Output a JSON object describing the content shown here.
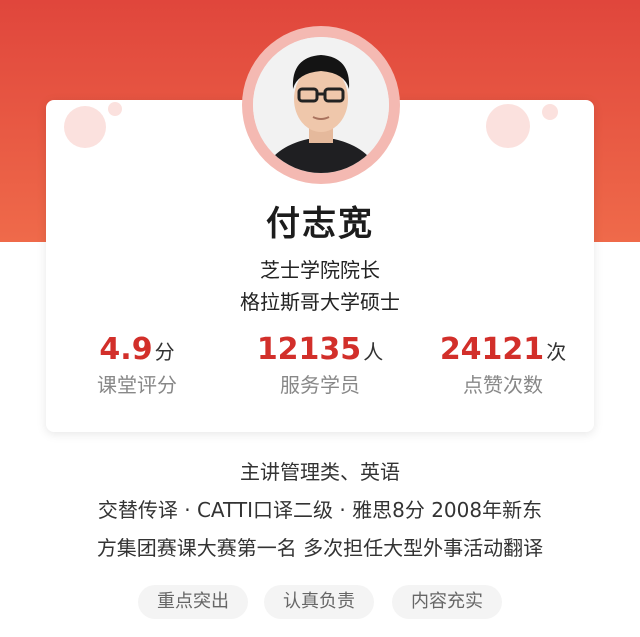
{
  "profile": {
    "name": "付志宽",
    "title_line1": "芝士学院院长",
    "title_line2": "格拉斯哥大学硕士"
  },
  "stats": [
    {
      "value": "4.9",
      "unit": "分",
      "label": "课堂评分"
    },
    {
      "value": "12135",
      "unit": "人",
      "label": "服务学员"
    },
    {
      "value": "24121",
      "unit": "次",
      "label": "点赞次数"
    }
  ],
  "description": {
    "line1": "主讲管理类、英语",
    "line2": "交替传译 · CATTI口译二级 · 雅思8分 2008年新东",
    "line3": "方集团赛课大赛第一名 多次担任大型外事活动翻译"
  },
  "tags": [
    "重点突出",
    "认真负责",
    "内容充实"
  ],
  "colors": {
    "header_bg": "#e0463c",
    "accent": "#d22f2a"
  }
}
